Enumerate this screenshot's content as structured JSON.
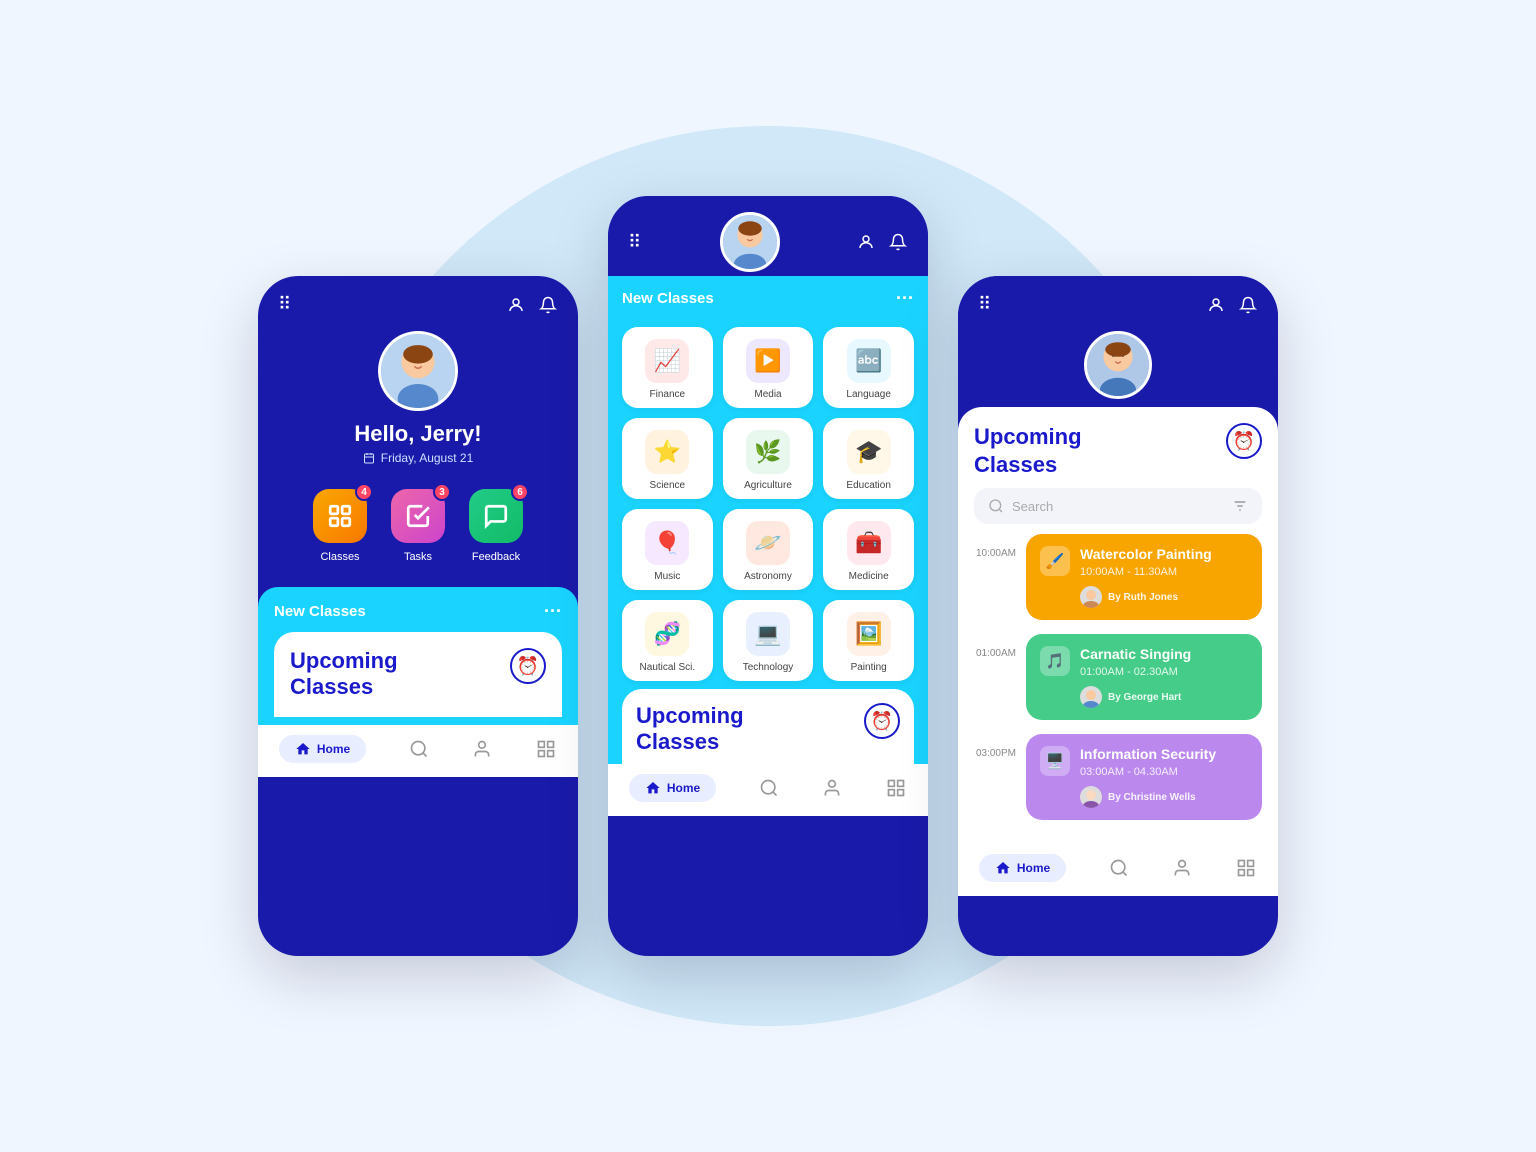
{
  "scene": {
    "bg_circle_color": "#c8e4f5"
  },
  "phone_left": {
    "greeting": "Hello, Jerry!",
    "date": "Friday, August 21",
    "quick_actions": [
      {
        "label": "Classes",
        "badge": "4",
        "color_class": "qa-classes"
      },
      {
        "label": "Tasks",
        "badge": "3",
        "color_class": "qa-tasks"
      },
      {
        "label": "Feedback",
        "badge": "6",
        "color_class": "qa-feedback"
      }
    ],
    "new_classes_label": "New Classes",
    "upcoming_label": "Upcoming",
    "classes_label": "Classes",
    "nav_home": "Home"
  },
  "phone_center": {
    "new_classes_label": "New Classes",
    "classes": [
      {
        "label": "Finance",
        "icon": "📈",
        "color_class": "icon-finance"
      },
      {
        "label": "Media",
        "icon": "▶️",
        "color_class": "icon-media"
      },
      {
        "label": "Language",
        "icon": "🔤",
        "color_class": "icon-language"
      },
      {
        "label": "Science",
        "icon": "⭐",
        "color_class": "icon-science"
      },
      {
        "label": "Agriculture",
        "icon": "🌿",
        "color_class": "icon-agri"
      },
      {
        "label": "Education",
        "icon": "🎓",
        "color_class": "icon-edu"
      },
      {
        "label": "Music",
        "icon": "🎈",
        "color_class": "icon-music"
      },
      {
        "label": "Astronomy",
        "icon": "🪐",
        "color_class": "icon-astro"
      },
      {
        "label": "Medicine",
        "icon": "🧰",
        "color_class": "icon-medicine"
      },
      {
        "label": "Nautical Sci.",
        "icon": "🧬",
        "color_class": "icon-nautical"
      },
      {
        "label": "Technology",
        "icon": "💻",
        "color_class": "icon-tech"
      },
      {
        "label": "Painting",
        "icon": "🖼️",
        "color_class": "icon-painting"
      }
    ],
    "upcoming_label": "Upcoming",
    "classes_label": "Classes",
    "nav_home": "Home"
  },
  "phone_right": {
    "title_line1": "Upcoming",
    "title_line2": "Classes",
    "search_placeholder": "Search",
    "schedule": [
      {
        "time": "10:00AM",
        "title": "Watercolor Painting",
        "time_range": "10:00AM - 11.30AM",
        "teacher": "By Ruth Jones",
        "color_class": "card-orange",
        "icon": "🖌️"
      },
      {
        "time": "01:00AM",
        "title": "Carnatic Singing",
        "time_range": "01:00AM - 02.30AM",
        "teacher": "By George Hart",
        "color_class": "card-green",
        "icon": "🎵"
      },
      {
        "time": "03:00PM",
        "title": "Information Security",
        "time_range": "03:00AM - 04.30AM",
        "teacher": "By Christine Wells",
        "color_class": "card-purple",
        "icon": "🖥️"
      }
    ],
    "nav_home": "Home"
  }
}
